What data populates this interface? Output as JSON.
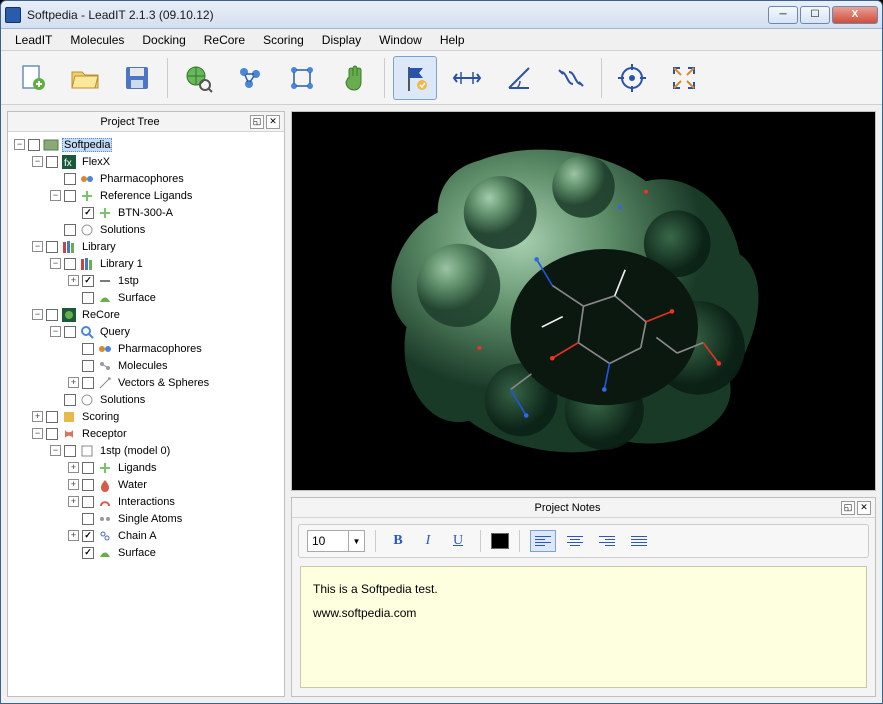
{
  "window": {
    "title": "Softpedia - LeadIT 2.1.3  (09.10.12)"
  },
  "menu": {
    "items": [
      "LeadIT",
      "Molecules",
      "Docking",
      "ReCore",
      "Scoring",
      "Display",
      "Window",
      "Help"
    ]
  },
  "toolbar": {
    "buttons": [
      {
        "name": "new-project",
        "icon": "document-plus"
      },
      {
        "name": "open",
        "icon": "folder"
      },
      {
        "name": "save",
        "icon": "floppy"
      },
      {
        "name": "sep"
      },
      {
        "name": "globe-search",
        "icon": "globe"
      },
      {
        "name": "molecule-blue",
        "icon": "mol-blue"
      },
      {
        "name": "molecule-connect",
        "icon": "mol-link"
      },
      {
        "name": "hand",
        "icon": "hand"
      },
      {
        "name": "sep"
      },
      {
        "name": "flag",
        "icon": "flag",
        "active": true
      },
      {
        "name": "distance",
        "icon": "distance"
      },
      {
        "name": "angle",
        "icon": "angle"
      },
      {
        "name": "torsion",
        "icon": "torsion"
      },
      {
        "name": "sep"
      },
      {
        "name": "center",
        "icon": "center"
      },
      {
        "name": "fullscreen",
        "icon": "expand"
      }
    ]
  },
  "project_tree": {
    "title": "Project Tree",
    "root": "Softpedia",
    "nodes": {
      "flexx": "FlexX",
      "pharm1": "Pharmacophores",
      "refligs": "Reference Ligands",
      "btn300a": "BTN-300-A",
      "solutions1": "Solutions",
      "library": "Library",
      "library1": "Library 1",
      "n1stp": "1stp",
      "surface1": "Surface",
      "recore": "ReCore",
      "query": "Query",
      "pharm2": "Pharmacophores",
      "molecules": "Molecules",
      "vectors": "Vectors & Spheres",
      "solutions2": "Solutions",
      "scoring": "Scoring",
      "receptor": "Receptor",
      "n1stp_m0": "1stp (model 0)",
      "ligands": "Ligands",
      "water": "Water",
      "interactions": "Interactions",
      "singleatoms": "Single Atoms",
      "chaina": "Chain A",
      "surface2": "Surface"
    }
  },
  "notes": {
    "title": "Project Notes",
    "font_size": "10",
    "text_line1": "This is a Softpedia test.",
    "text_line2": "www.softpedia.com"
  }
}
